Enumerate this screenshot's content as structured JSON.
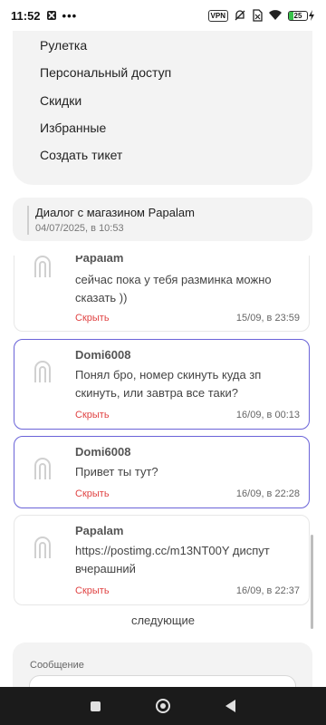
{
  "status_bar": {
    "time": "11:52",
    "vpn_label": "VPN",
    "battery_percent": "25",
    "battery_level": 0.25
  },
  "menu": {
    "items": [
      "Рулетка",
      "Персональный доступ",
      "Скидки",
      "Избранные",
      "Создать тикет"
    ]
  },
  "dialog": {
    "title": "Диалог с магазином Papalam",
    "date": "04/07/2025, в 10:53"
  },
  "messages": [
    {
      "author": "Papalam",
      "text": "сейчас пока у тебя разминка можно сказать ))",
      "hide_label": "Скрыть",
      "time": "15/09, в 23:59",
      "own": false
    },
    {
      "author": "Domi6008",
      "text": "Понял бро, номер скинуть куда зп скинуть, или завтра все таки?",
      "hide_label": "Скрыть",
      "time": "16/09, в 00:13",
      "own": true
    },
    {
      "author": "Domi6008",
      "text": "Привет ты тут?",
      "hide_label": "Скрыть",
      "time": "16/09, в 22:28",
      "own": true
    },
    {
      "author": "Papalam",
      "text": "https://postimg.cc/m13NT00Y диспут вчерашний",
      "hide_label": "Скрыть",
      "time": "16/09, в 22:37",
      "own": false
    }
  ],
  "pagination": {
    "next_label": "следующие"
  },
  "compose": {
    "label": "Сообщение"
  },
  "colors": {
    "own_border": "#6a63d8",
    "hide_red": "#e04444",
    "card_bg": "#f3f3f3"
  },
  "icons": {
    "avatar": "papalam-logo-icon",
    "nav": [
      "recents-square-icon",
      "home-circle-icon",
      "back-triangle-icon"
    ]
  }
}
